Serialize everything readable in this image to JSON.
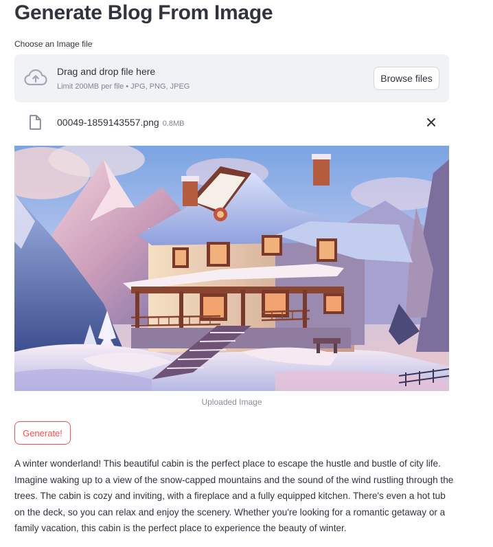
{
  "page": {
    "title": "Generate Blog From Image"
  },
  "uploader": {
    "label": "Choose an Image file",
    "drag_text": "Drag and drop file here",
    "limit_text": "Limit 200MB per file • JPG, PNG, JPEG",
    "browse_label": "Browse files",
    "icon": "cloud-upload-icon"
  },
  "uploaded_file": {
    "name": "00049-1859143557.png",
    "size": "0.8MB",
    "icon": "file-icon",
    "remove_icon": "close-icon"
  },
  "image": {
    "caption": "Uploaded Image"
  },
  "actions": {
    "generate_label": "Generate!"
  },
  "blog": {
    "text": "A winter wonderland! This beautiful cabin is the perfect place to escape the hustle and bustle of city life. Imagine waking up to a view of the snow-capped mountains and the sound of the wind rustling through the trees. The cabin is cozy and inviting, with a fireplace and a fully equipped kitchen. There's even a hot tub on the deck, so you can relax and enjoy the scenery. Whether you're looking for a romantic getaway or a family vacation, this cabin is the perfect place to experience the beauty of winter."
  },
  "colors": {
    "accent": "#ff4b4b",
    "dropzone_bg": "#f0f2f6",
    "text": "#31333f",
    "muted": "#808495"
  }
}
